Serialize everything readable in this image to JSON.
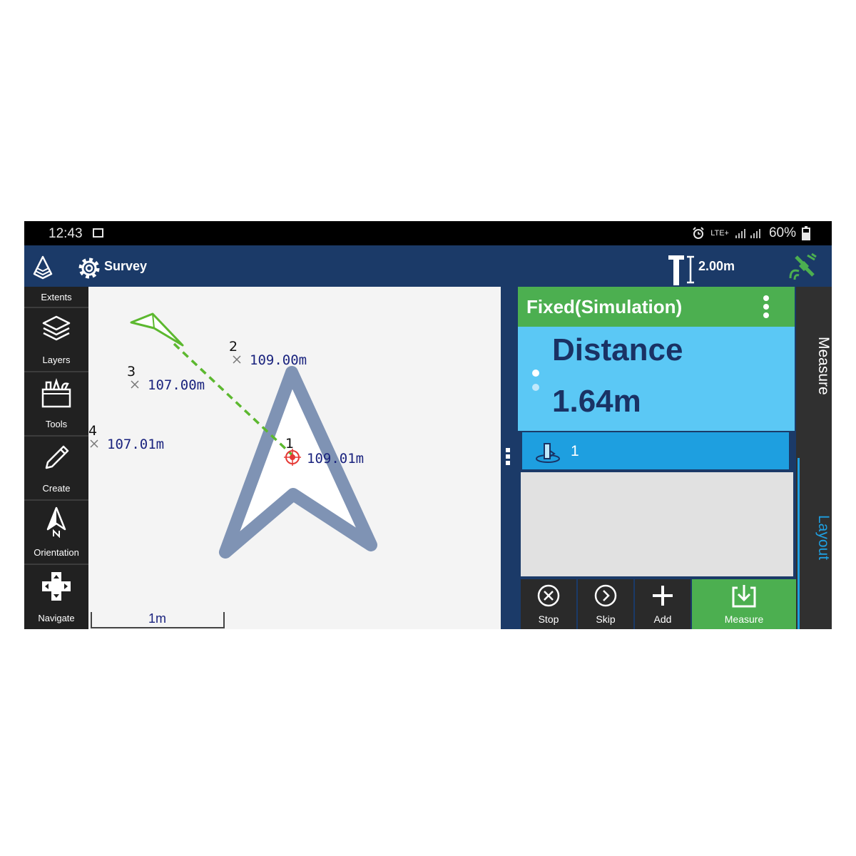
{
  "status_bar": {
    "time": "12:43",
    "network_label": "LTE+",
    "battery": "60%",
    "icons": [
      "image-icon",
      "alarm-icon",
      "signal-icon",
      "battery-icon"
    ]
  },
  "app_bar": {
    "mode_label": "Survey",
    "pole_height": "2.00m",
    "icons": [
      "app-logo-icon",
      "gear-icon",
      "survey-pole-icon",
      "satellite-icon"
    ]
  },
  "toolbar": {
    "items": [
      {
        "label": "Extents",
        "icon": "extents-icon"
      },
      {
        "label": "Layers",
        "icon": "layers-icon"
      },
      {
        "label": "Tools",
        "icon": "toolbox-icon"
      },
      {
        "label": "Create",
        "icon": "pencil-icon"
      },
      {
        "label": "Orientation",
        "icon": "north-arrow-icon"
      },
      {
        "label": "Navigate",
        "icon": "dpad-icon"
      }
    ]
  },
  "map": {
    "points": [
      {
        "id": "1",
        "label": "109.01m"
      },
      {
        "id": "2",
        "label": "109.00m"
      },
      {
        "id": "3",
        "label": "107.00m"
      },
      {
        "id": "4",
        "label": "107.01m"
      }
    ],
    "scale_label": "1m",
    "colors": {
      "target_arrow": "#7f93b4",
      "guide_line": "#5cb82f",
      "labels": "#1a237e"
    }
  },
  "panel": {
    "status_title": "Fixed(Simulation)",
    "metric_name": "Distance",
    "metric_value": "1.64m",
    "selected_point": "1",
    "buttons": [
      {
        "label": "Stop",
        "icon": "close-circle-icon"
      },
      {
        "label": "Skip",
        "icon": "chevron-right-circle-icon"
      },
      {
        "label": "Add",
        "icon": "plus-icon"
      },
      {
        "label": "Measure",
        "icon": "measure-download-icon"
      }
    ],
    "colors": {
      "header": "#4caf50",
      "metric_box": "#5bc8f5",
      "selected_row": "#1e9fe0"
    }
  },
  "side_tabs": {
    "measure": "Measure",
    "layout": "Layout"
  }
}
